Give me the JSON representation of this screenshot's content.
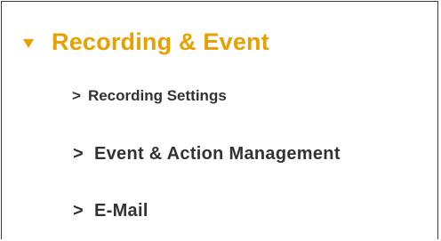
{
  "section": {
    "title": "Recording & Event",
    "expand_icon": "triangle-down-icon",
    "accent_color": "#e6a100"
  },
  "menu": {
    "items": [
      {
        "chevron": ">",
        "label": "Recording Settings"
      },
      {
        "chevron": ">",
        "label": "Event & Action Management"
      },
      {
        "chevron": ">",
        "label": "E-Mail"
      }
    ]
  }
}
